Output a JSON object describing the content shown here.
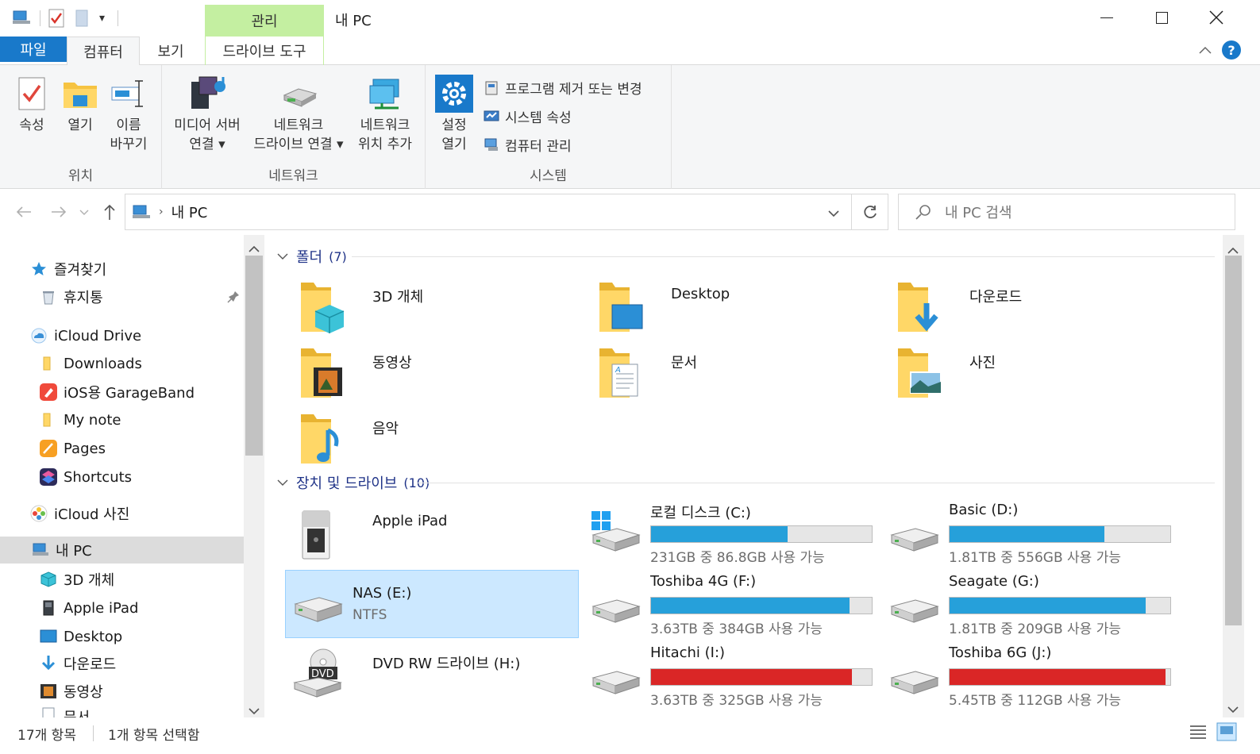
{
  "window": {
    "title": "내 PC",
    "context_tab_header": "관리"
  },
  "tabs": {
    "file": "파일",
    "computer": "컴퓨터",
    "view": "보기",
    "drive_tools": "드라이브 도구"
  },
  "ribbon": {
    "location_group": {
      "label": "위치",
      "properties": "속성",
      "open": "열기",
      "rename_line1": "이름",
      "rename_line2": "바꾸기"
    },
    "network_group": {
      "label": "네트워크",
      "media_line1": "미디어 서버",
      "media_line2": "연결 ▾",
      "map_line1": "네트워크",
      "map_line2": "드라이브 연결 ▾",
      "add_line1": "네트워크",
      "add_line2": "위치 추가"
    },
    "system_group": {
      "label": "시스템",
      "settings_line1": "설정",
      "settings_line2": "열기",
      "uninstall": "프로그램 제거 또는 변경",
      "system_props": "시스템 속성",
      "manage": "컴퓨터 관리"
    }
  },
  "address": {
    "path": "내 PC",
    "search_placeholder": "내 PC 검색"
  },
  "navpane": {
    "favorites": "즐겨찾기",
    "recycle": "휴지통",
    "icloud_drive": "iCloud Drive",
    "downloads": "Downloads",
    "garageband": "iOS용 GarageBand",
    "mynote": "My note",
    "pages": "Pages",
    "shortcuts": "Shortcuts",
    "icloud_photos": "iCloud 사진",
    "this_pc": "내 PC",
    "objects3d": "3D 개체",
    "ipad": "Apple iPad",
    "desktop": "Desktop",
    "pc_downloads": "다운로드",
    "videos": "동영상",
    "documents_partial": "문서"
  },
  "folders_section": {
    "title": "폴더",
    "count": "(7)",
    "items": [
      "3D 개체",
      "Desktop",
      "다운로드",
      "동영상",
      "문서",
      "사진",
      "음악"
    ]
  },
  "drives_section": {
    "title": "장치 및 드라이브",
    "count": "(10)",
    "ipad": "Apple iPad",
    "nas_name": "NAS (E:)",
    "nas_fs": "NTFS",
    "dvd": "DVD RW 드라이브 (H:)",
    "drives": [
      {
        "name": "로컬 디스크 (C:)",
        "free": "231GB 중 86.8GB 사용 가능",
        "used_fraction": 0.62,
        "color": "#26a0da"
      },
      {
        "name": "Basic (D:)",
        "free": "1.81TB 중 556GB 사용 가능",
        "used_fraction": 0.7,
        "color": "#26a0da"
      },
      {
        "name": "Toshiba 4G (F:)",
        "free": "3.63TB 중 384GB 사용 가능",
        "used_fraction": 0.9,
        "color": "#26a0da"
      },
      {
        "name": "Seagate (G:)",
        "free": "1.81TB 중 209GB 사용 가능",
        "used_fraction": 0.89,
        "color": "#26a0da"
      },
      {
        "name": "Hitachi (I:)",
        "free": "3.63TB 중 325GB 사용 가능",
        "used_fraction": 0.91,
        "color": "#da2626"
      },
      {
        "name": "Toshiba 6G (J:)",
        "free": "5.45TB 중 112GB 사용 가능",
        "used_fraction": 0.98,
        "color": "#da2626"
      }
    ]
  },
  "status": {
    "item_count": "17개 항목",
    "selected": "1개 항목 선택함"
  },
  "colors": {
    "accent": "#1979ca",
    "context_tab": "#c4efa1",
    "selection": "#cce8ff",
    "bar_normal": "#26a0da",
    "bar_full": "#da2626"
  }
}
